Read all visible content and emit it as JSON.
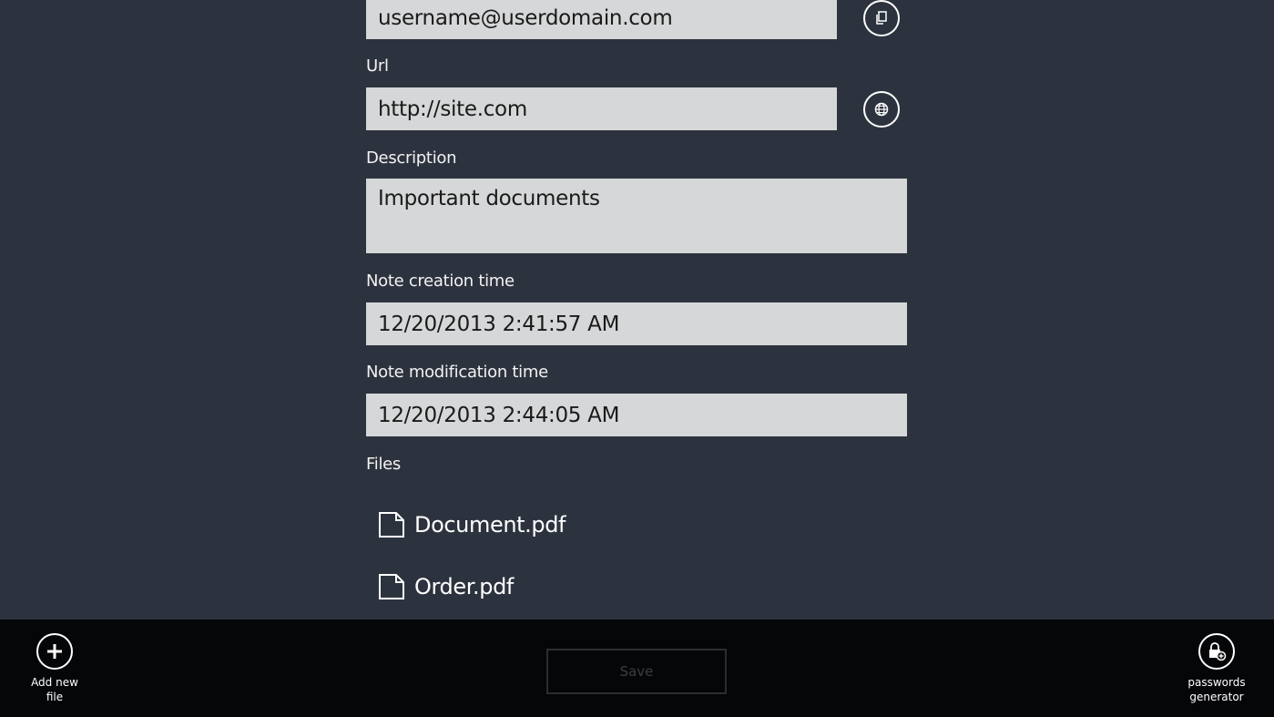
{
  "form": {
    "username_value": "username@userdomain.com",
    "url_label": "Url",
    "url_value": "http://site.com",
    "description_label": "Description",
    "description_value": "Important documents",
    "creation_label": "Note creation time",
    "creation_value": "12/20/2013 2:41:57 AM",
    "modification_label": "Note modification time",
    "modification_value": "12/20/2013 2:44:05 AM",
    "files_label": "Files"
  },
  "files": [
    {
      "name": "Document.pdf",
      "icon": "file-icon"
    },
    {
      "name": "Order.pdf",
      "icon": "file-icon"
    }
  ],
  "appbar": {
    "add_file_label": "Add new file",
    "save_label": "Save",
    "generator_label_line1": "passwords",
    "generator_label_line2": "generator"
  },
  "icons": {
    "copy": "copy-icon",
    "globe": "globe-icon",
    "add": "plus-icon",
    "generator": "lock-add-icon"
  },
  "colors": {
    "background": "#2d333e",
    "field": "#d6d7d8",
    "appbar": "#050608"
  }
}
